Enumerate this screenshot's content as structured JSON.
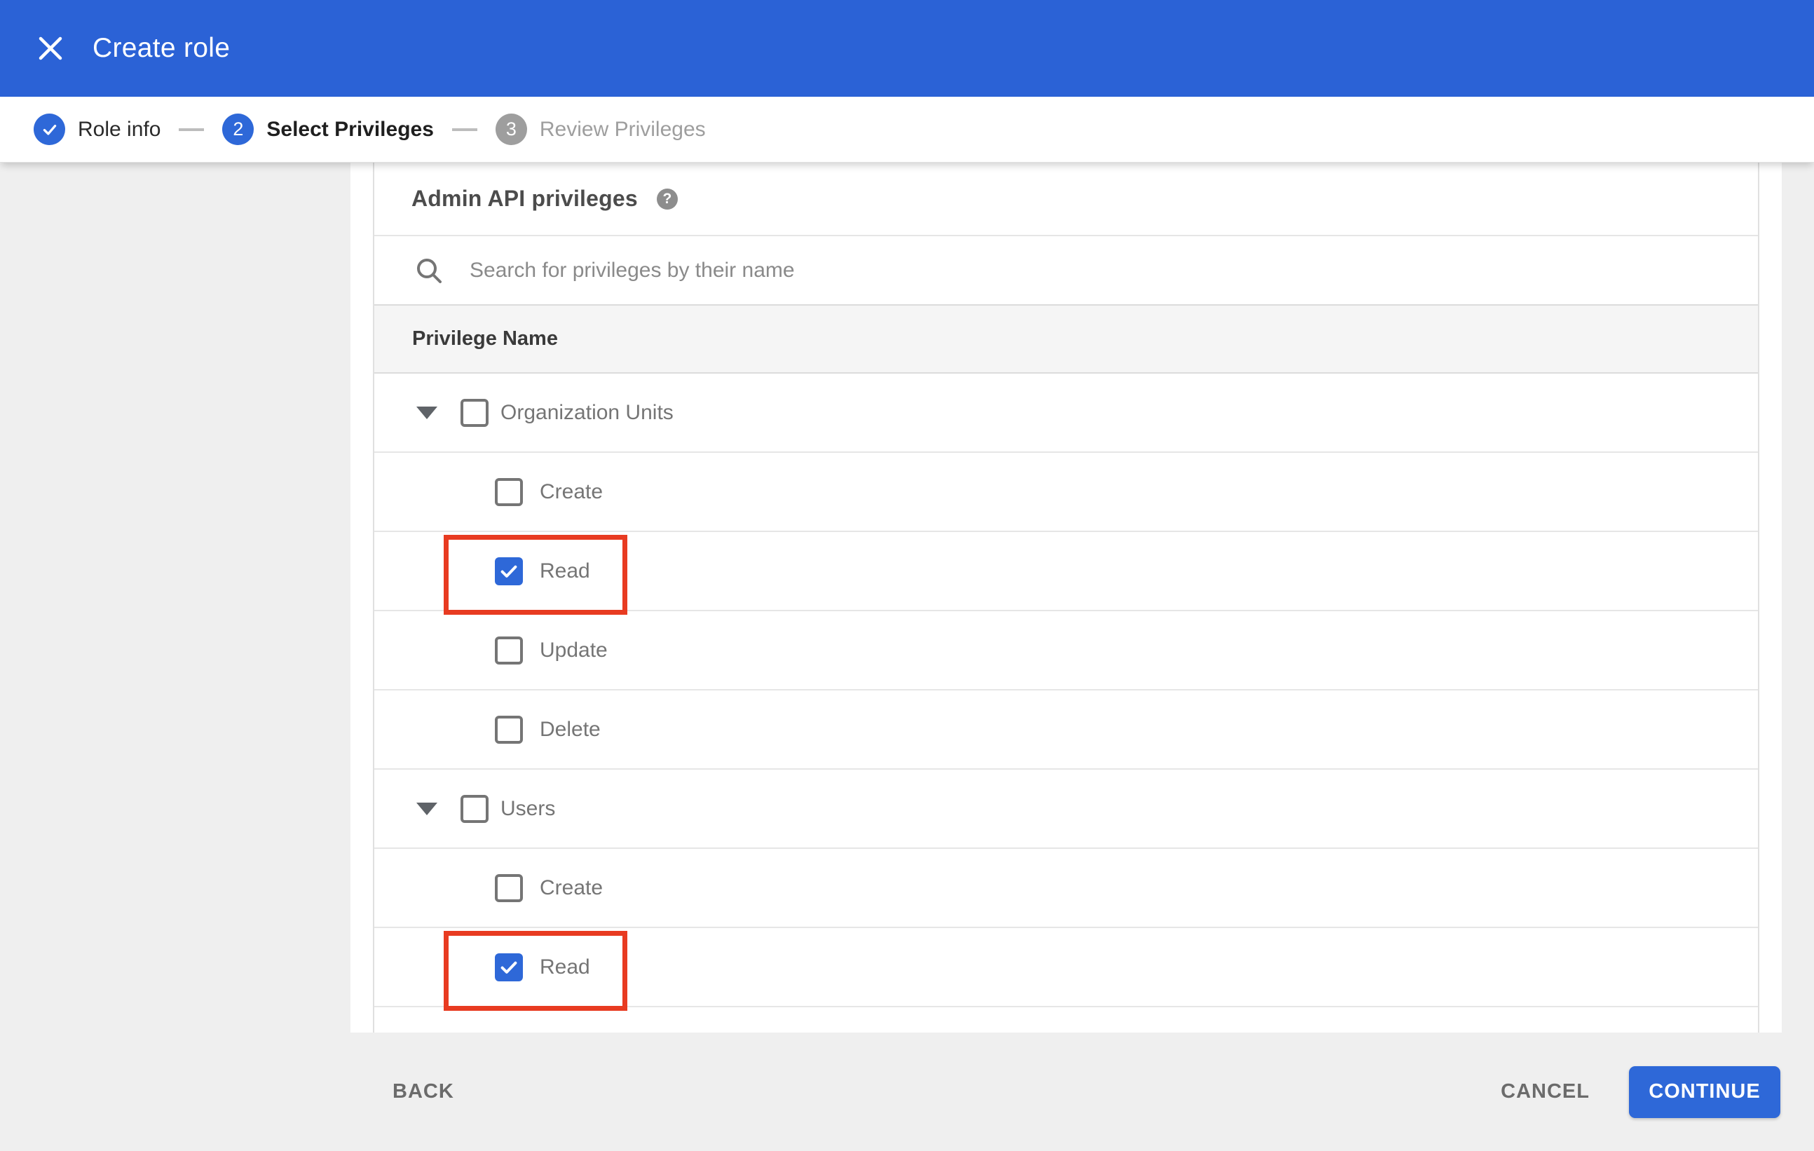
{
  "colors": {
    "header_blue": "#2b62d6",
    "accent_blue": "#2e68d8",
    "highlight_red": "#e83b21",
    "page_bg": "#efefef",
    "table_header_bg": "#f5f5f5",
    "row_border": "#e6e6e6",
    "header_row_border": "#dcdcdc",
    "text_dark": "#3f3f3f",
    "text_gray": "#757575",
    "inactive_gray": "#9e9e9e"
  },
  "header": {
    "title": "Create role"
  },
  "stepper": {
    "steps": [
      {
        "number": "1",
        "label": "Role info",
        "state": "complete"
      },
      {
        "number": "2",
        "label": "Select Privileges",
        "state": "active"
      },
      {
        "number": "3",
        "label": "Review Privileges",
        "state": "upcoming"
      }
    ]
  },
  "panel": {
    "title": "Admin API privileges",
    "help_symbol": "?",
    "search_placeholder": "Search for privileges by their name",
    "column_header": "Privilege Name"
  },
  "privileges": {
    "rows": [
      {
        "type": "group",
        "label": "Organization Units",
        "checked": false,
        "expanded": true,
        "highlighted": false
      },
      {
        "type": "child",
        "label": "Create",
        "checked": false,
        "highlighted": false
      },
      {
        "type": "child",
        "label": "Read",
        "checked": true,
        "highlighted": true
      },
      {
        "type": "child",
        "label": "Update",
        "checked": false,
        "highlighted": false
      },
      {
        "type": "child",
        "label": "Delete",
        "checked": false,
        "highlighted": false
      },
      {
        "type": "group",
        "label": "Users",
        "checked": false,
        "expanded": true,
        "highlighted": false
      },
      {
        "type": "child",
        "label": "Create",
        "checked": false,
        "highlighted": false
      },
      {
        "type": "child",
        "label": "Read",
        "checked": true,
        "highlighted": true
      }
    ]
  },
  "footer": {
    "back": "BACK",
    "cancel": "CANCEL",
    "continue": "CONTINUE"
  }
}
